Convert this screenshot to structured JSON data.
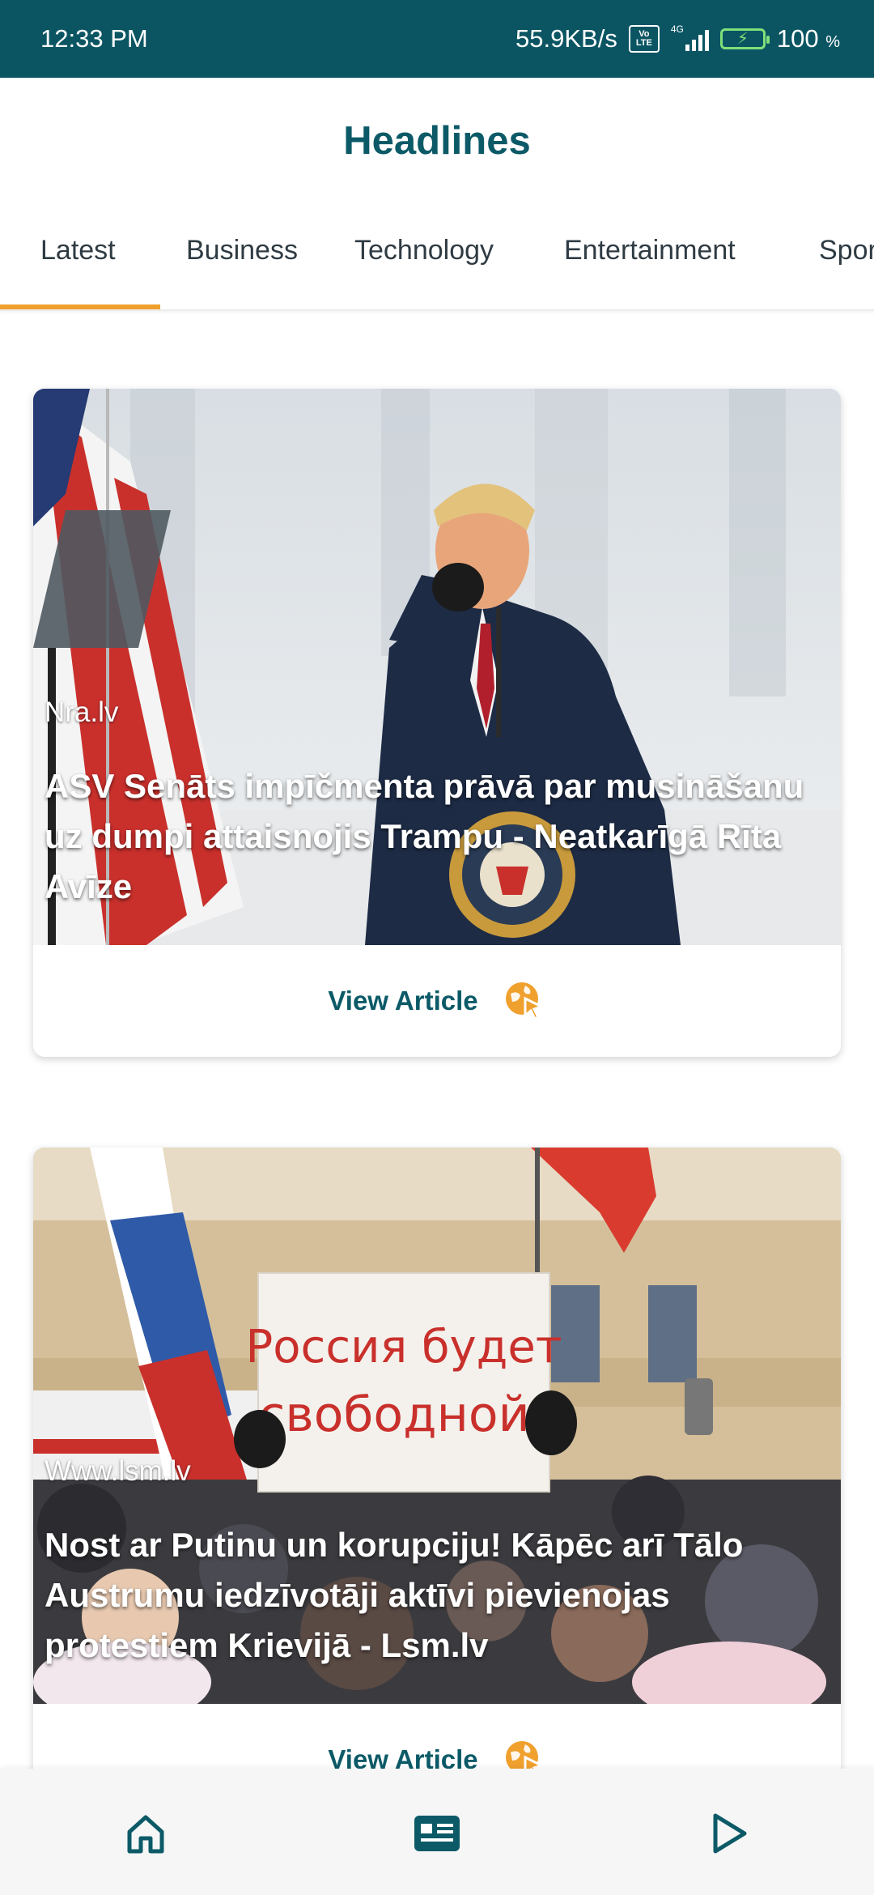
{
  "status_bar": {
    "time": "12:33 PM",
    "network_speed": "55.9KB/s",
    "volte_top": "Vo",
    "volte_bottom": "LTE",
    "signal_label": "4G",
    "battery_percent": "100",
    "battery_unit": "%"
  },
  "header": {
    "title": "Headlines"
  },
  "tabs": [
    {
      "label": "Latest",
      "selected": true
    },
    {
      "label": "Business",
      "selected": false
    },
    {
      "label": "Technology",
      "selected": false
    },
    {
      "label": "Entertainment",
      "selected": false
    },
    {
      "label": "Spor",
      "selected": false
    }
  ],
  "articles": [
    {
      "source": "Nra.lv",
      "headline": "ASV Senāts impīčmenta prāvā par musināšanu uz dumpi attaisnojis Trampu - Neatkarīgā Rīta Avīze",
      "action_label": "View Article"
    },
    {
      "source": "Www.lsm.lv",
      "headline": "Nost ar Putinu un korupciju! Kāpēc arī Tālo Austrumu iedzīvotāji aktīvi pievienojas protestiem Krievijā - Lsm.lv",
      "sign_text_line1": "Россия будет",
      "sign_text_line2": "свободной!",
      "action_label": "View Article"
    }
  ],
  "bottom_nav": {
    "items": [
      "home-icon",
      "news-icon",
      "play-icon"
    ]
  },
  "colors": {
    "status_bar_bg": "#0b5563",
    "accent": "#f0a02d",
    "primary_text": "#0c5a67"
  }
}
